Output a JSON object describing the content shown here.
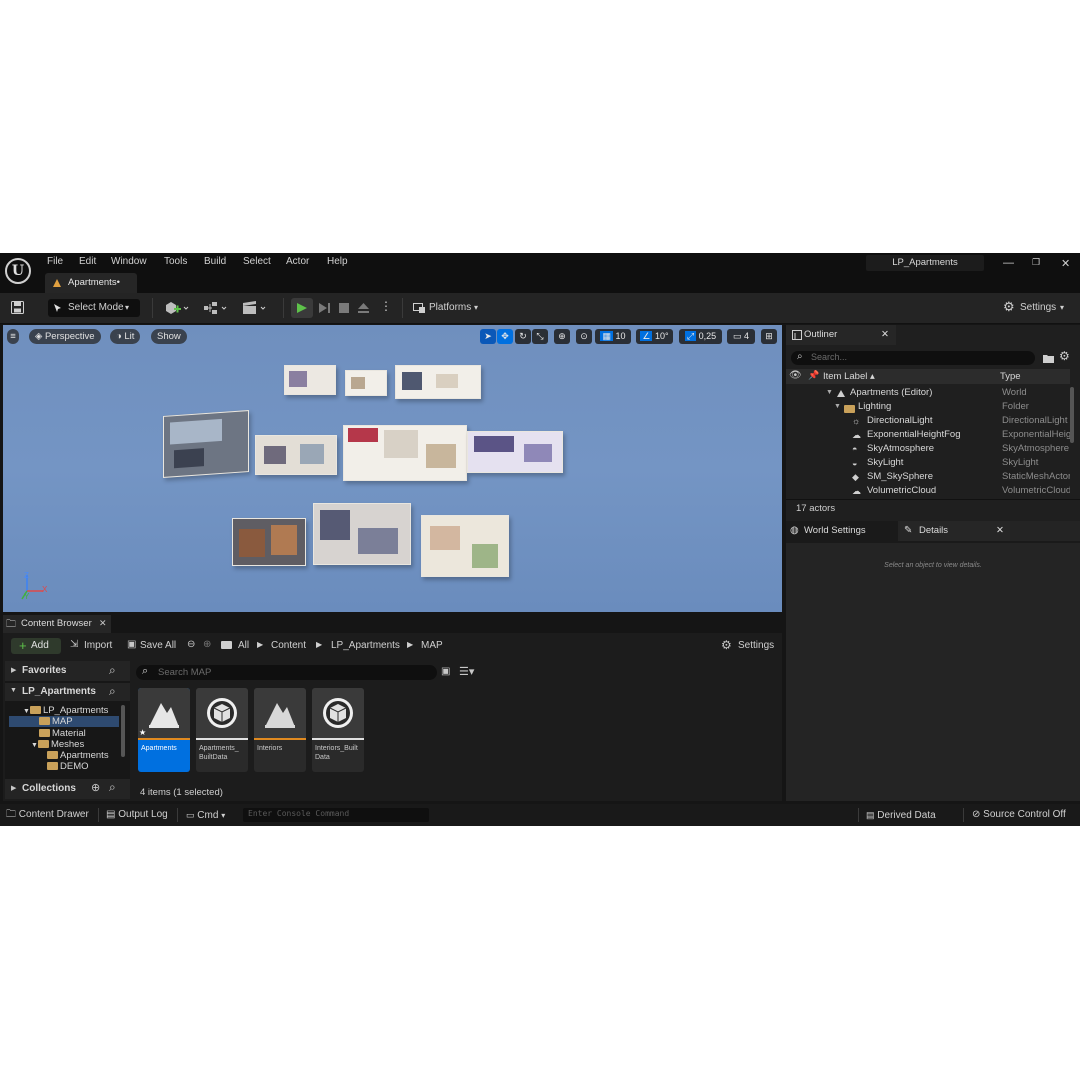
{
  "menu": [
    "File",
    "Edit",
    "Window",
    "Tools",
    "Build",
    "Select",
    "Actor",
    "Help"
  ],
  "project_name": "LP_Apartments",
  "window_controls": {
    "minimize": "—",
    "restore": "❐",
    "close": "✕"
  },
  "document_tab": "Apartments•",
  "toolbar": {
    "select_mode": "Select Mode",
    "platforms": "Platforms",
    "settings": "Settings"
  },
  "viewport": {
    "perspective": "Perspective",
    "lit": "Lit",
    "show": "Show",
    "grid_snap": "10",
    "rotation_snap": "10°",
    "scale_snap": "0,25",
    "camera_speed": "4",
    "axis_z": "Z",
    "axis_x": "X",
    "axis_y": "Y"
  },
  "outliner": {
    "tab": "Outliner",
    "search_placeholder": "Search...",
    "col_label": "Item Label ▴",
    "col_type": "Type",
    "rows": [
      {
        "label": "Apartments (Editor)",
        "type": "World"
      },
      {
        "label": "Lighting",
        "type": "Folder"
      },
      {
        "label": "DirectionalLight",
        "type": "DirectionalLight"
      },
      {
        "label": "ExponentialHeightFog",
        "type": "ExponentialHeightFog"
      },
      {
        "label": "SkyAtmosphere",
        "type": "SkyAtmosphere"
      },
      {
        "label": "SkyLight",
        "type": "SkyLight"
      },
      {
        "label": "SM_SkySphere",
        "type": "StaticMeshActor"
      },
      {
        "label": "VolumetricCloud",
        "type": "VolumetricCloud"
      }
    ],
    "actor_count": "17 actors"
  },
  "details": {
    "world_settings_tab": "World Settings",
    "details_tab": "Details",
    "empty_message": "Select an object to view details."
  },
  "content_browser": {
    "tab": "Content Browser",
    "add": "Add",
    "import": "Import",
    "save_all": "Save All",
    "breadcrumb": [
      "All",
      "Content",
      "LP_Apartments",
      "MAP"
    ],
    "settings": "Settings",
    "favorites": "Favorites",
    "root": "LP_Apartments",
    "search_placeholder": "Search MAP",
    "tree": [
      "LP_Apartments",
      "MAP",
      "Material",
      "Meshes",
      "Apartments",
      "DEMO"
    ],
    "collections": "Collections",
    "assets": [
      {
        "name": "Apartments",
        "kind": "level"
      },
      {
        "name": "Apartments_ BuiltData",
        "kind": "data"
      },
      {
        "name": "Interiors",
        "kind": "level"
      },
      {
        "name": "Interiors_Built Data",
        "kind": "data"
      }
    ],
    "item_count": "4 items (1 selected)"
  },
  "statusbar": {
    "content_drawer": "Content Drawer",
    "output_log": "Output Log",
    "cmd": "Cmd",
    "console_placeholder": "Enter Console Command",
    "derived_data": "Derived Data",
    "source_control": "Source Control Off"
  },
  "colors": {
    "accent": "#0070e0",
    "play_green": "#5ec24a",
    "viewport_blue": "#7193c2"
  }
}
